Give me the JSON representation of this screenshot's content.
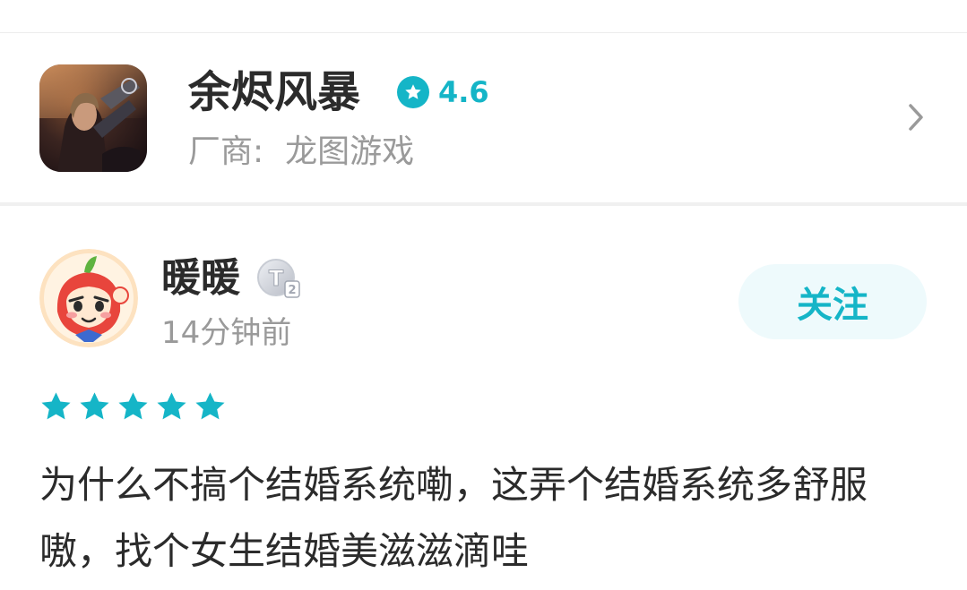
{
  "game": {
    "icon": "game-cover-art",
    "title": "余烬风暴",
    "rating_icon": "star-badge-icon",
    "rating": "4.6",
    "vendor_label": "厂商:",
    "vendor_name": "龙图游戏",
    "nav_icon": "chevron-right-icon"
  },
  "review": {
    "avatar": "apple-character-avatar",
    "username": "暖暖",
    "level_badge": "T2",
    "timestamp": "14分钟前",
    "follow_label": "关注",
    "stars": 5,
    "stars_max": 5,
    "text": "为什么不搞个结婚系统嘞，这弄个结婚系统多舒服嗷，找个女生结婚美滋滋滴哇"
  },
  "colors": {
    "accent": "#15b5c7",
    "title": "#2b2b2b",
    "muted": "#9a9a9a",
    "follow_bg": "#eefafc"
  }
}
